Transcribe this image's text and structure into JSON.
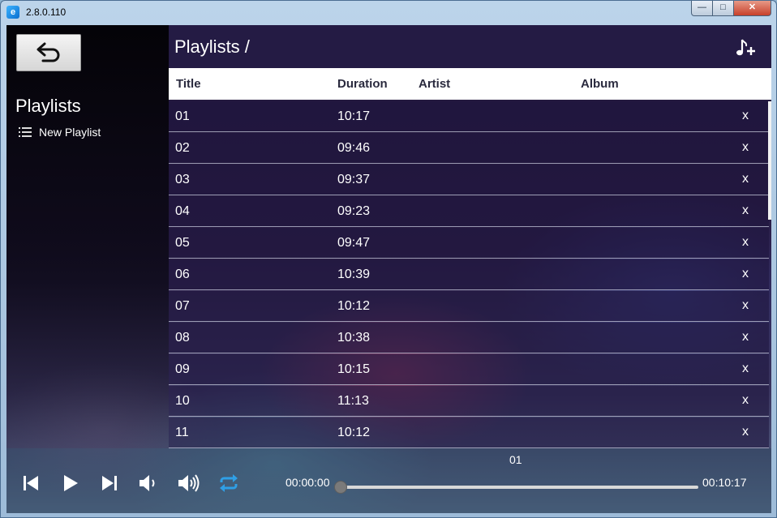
{
  "window": {
    "title": "2.8.0.110",
    "controls": {
      "minimize": "—",
      "maximize": "□",
      "close": "✕"
    },
    "icons": {
      "app": "app-logo-icon"
    }
  },
  "sidebar": {
    "title": "Playlists",
    "items": [
      {
        "label": "New Playlist",
        "icon": "list-icon"
      }
    ],
    "back_icon": "back-arrow-icon"
  },
  "header": {
    "title": "Playlists /",
    "add_icon": "add-music-icon"
  },
  "table": {
    "columns": [
      "Title",
      "Duration",
      "Artist",
      "Album"
    ],
    "delete_label": "x",
    "rows": [
      {
        "title": "01",
        "duration": "10:17"
      },
      {
        "title": "02",
        "duration": "09:46"
      },
      {
        "title": "03",
        "duration": "09:37"
      },
      {
        "title": "04",
        "duration": "09:23"
      },
      {
        "title": "05",
        "duration": "09:47"
      },
      {
        "title": "06",
        "duration": "10:39"
      },
      {
        "title": "07",
        "duration": "10:12"
      },
      {
        "title": "08",
        "duration": "10:38"
      },
      {
        "title": "09",
        "duration": "10:15"
      },
      {
        "title": "10",
        "duration": "11:13"
      },
      {
        "title": "11",
        "duration": "10:12"
      }
    ]
  },
  "player": {
    "current_track": "01",
    "elapsed": "00:00:00",
    "total": "00:10:17",
    "progress": 0.0,
    "accent_color": "#2f9fe6",
    "icons": [
      "skip-previous-icon",
      "play-icon",
      "skip-next-icon",
      "volume-down-icon",
      "volume-up-icon",
      "repeat-icon"
    ]
  }
}
